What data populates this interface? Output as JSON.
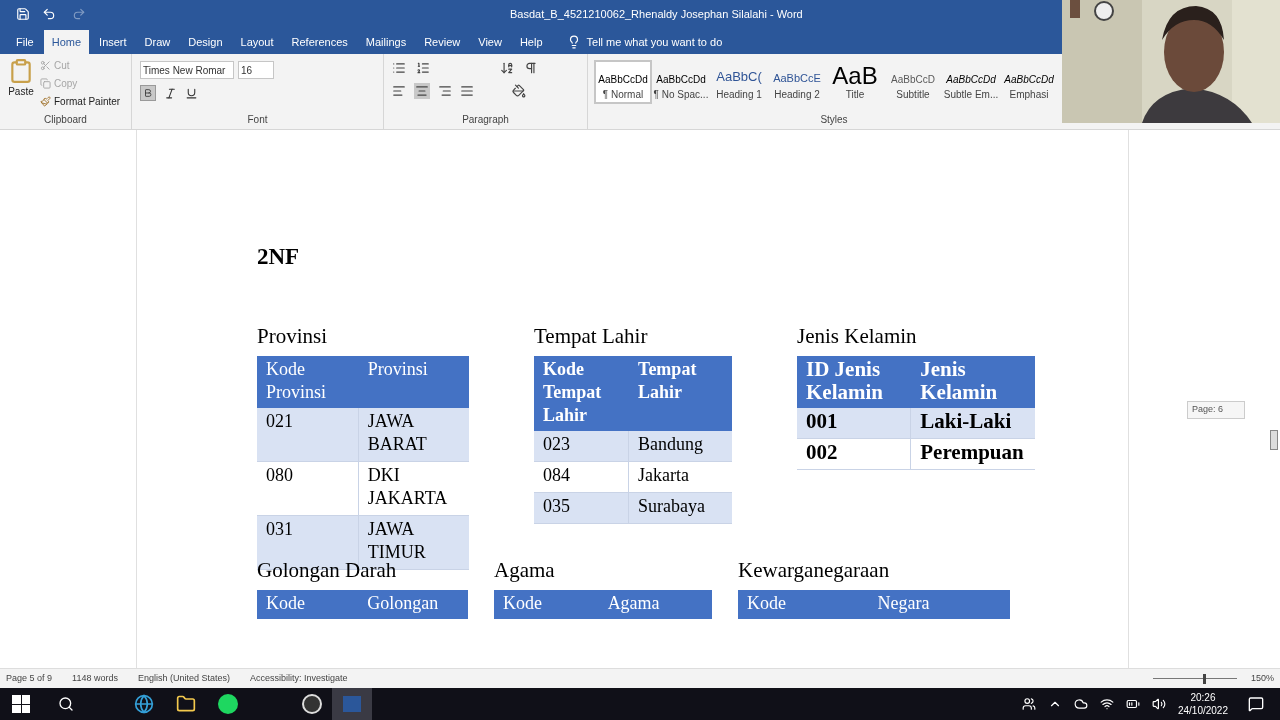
{
  "window": {
    "title": "Basdat_B_4521210062_Rhenaldy Josephan Silalahi  -  Word"
  },
  "tabs": [
    {
      "label": "File",
      "selected": false
    },
    {
      "label": "Home",
      "selected": true
    },
    {
      "label": "Insert",
      "selected": false
    },
    {
      "label": "Draw",
      "selected": false
    },
    {
      "label": "Design",
      "selected": false
    },
    {
      "label": "Layout",
      "selected": false
    },
    {
      "label": "References",
      "selected": false
    },
    {
      "label": "Mailings",
      "selected": false
    },
    {
      "label": "Review",
      "selected": false
    },
    {
      "label": "View",
      "selected": false
    },
    {
      "label": "Help",
      "selected": false
    }
  ],
  "tell_me": "Tell me what you want to do",
  "clipboard": {
    "paste": "Paste",
    "cut": {
      "label": "Cut",
      "disabled": true
    },
    "copy": {
      "label": "Copy",
      "disabled": true
    },
    "format_painter": {
      "label": "Format Painter",
      "disabled": false
    },
    "label": "Clipboard"
  },
  "font": {
    "name": "Times New Romar",
    "size": "16",
    "bold": true,
    "label": "Font"
  },
  "paragraph": {
    "label": "Paragraph",
    "align_center": true
  },
  "styles": {
    "label": "Styles",
    "items": [
      {
        "preview": "AaBbCcDd",
        "name": "¶ Normal",
        "selected": true,
        "kind": "plain"
      },
      {
        "preview": "AaBbCcDd",
        "name": "¶ No Spac...",
        "selected": false,
        "kind": "plain"
      },
      {
        "preview": "AaBbC(",
        "name": "Heading 1",
        "selected": false,
        "kind": "heading1"
      },
      {
        "preview": "AaBbCcE",
        "name": "Heading 2",
        "selected": false,
        "kind": "heading2"
      },
      {
        "preview": "AaB",
        "name": "Title",
        "selected": false,
        "kind": "title"
      },
      {
        "preview": "AaBbCcD",
        "name": "Subtitle",
        "selected": false,
        "kind": "subtitle"
      },
      {
        "preview": "AaBbCcDd",
        "name": "Subtle Em...",
        "selected": false,
        "kind": "italic"
      },
      {
        "preview": "AaBbCcDd",
        "name": "Emphasi",
        "selected": false,
        "kind": "italic"
      }
    ]
  },
  "document": {
    "heading": "2NF",
    "page_badge": "Page: 6",
    "tables": [
      {
        "title": "Provinsi",
        "kind": "plain",
        "header": [
          "Kode Provinsi",
          "Provinsi"
        ],
        "rows": [
          [
            "021",
            "JAWA BARAT"
          ],
          [
            "080",
            "DKI JAKARTA"
          ],
          [
            "031",
            "JAWA TIMUR"
          ]
        ]
      },
      {
        "title": "Tempat Lahir",
        "kind": "bold",
        "header": [
          "Kode Tempat Lahir",
          "Tempat Lahir"
        ],
        "rows": [
          [
            "023",
            "Bandung"
          ],
          [
            "084",
            "Jakarta"
          ],
          [
            "035",
            "Surabaya"
          ]
        ]
      },
      {
        "title": "Jenis Kelamin",
        "kind": "large",
        "header": [
          "ID Jenis Kelamin",
          "Jenis Kelamin"
        ],
        "rows": [
          [
            "001",
            "Laki-Laki"
          ],
          [
            "002",
            "Perempuan"
          ]
        ]
      },
      {
        "title": "Golongan Darah",
        "kind": "plain",
        "header": [
          "Kode",
          "Golongan"
        ]
      },
      {
        "title": "Agama",
        "kind": "plain",
        "header": [
          "Kode",
          "Agama"
        ]
      },
      {
        "title": "Kewarganegaraan",
        "kind": "plain",
        "header": [
          "Kode",
          "Negara"
        ]
      }
    ]
  },
  "status_bar": {
    "page": "Page 5 of 9",
    "words": "1148 words",
    "language": "English (United States)",
    "accessibility": "Accessibility: Investigate",
    "zoom": "150%",
    "zoom_slider": {
      "level": 0.6
    }
  },
  "taskbar": {
    "time": "20:26",
    "date": "24/10/2022"
  }
}
